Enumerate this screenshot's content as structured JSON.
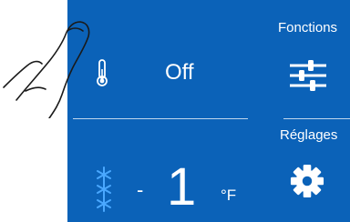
{
  "status": {
    "heater_label": "Off"
  },
  "menu": {
    "functions_label": "Fonctions",
    "settings_label": "Réglages"
  },
  "temperature": {
    "sign": "-",
    "value": "1",
    "unit": "°F"
  },
  "icons": {
    "status_icon": "thermometer-icon",
    "functions_icon": "sliders-icon",
    "settings_icon": "gear-icon",
    "mode_icon": "snowflake-icon"
  },
  "colors": {
    "panel": "#0b62b8",
    "text": "#ffffff",
    "snowflake": "#4aa8ff"
  }
}
